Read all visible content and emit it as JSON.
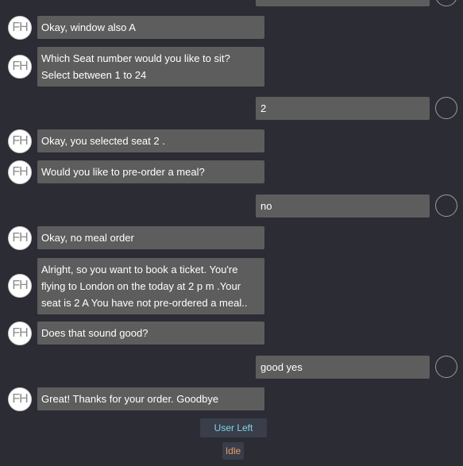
{
  "avatar_initials": "FH",
  "messages": {
    "m1": "Okay, window also A",
    "m2": "Which Seat number would you like to sit?\nSelect between 1 to 24",
    "u1": "2",
    "m3": "Okay, you selected seat 2 .",
    "m4": "Would you like to pre-order a meal?",
    "u2": "no",
    "m5": "Okay, no meal order",
    "m6": "Alright, so you want to book a ticket. You're flying to London on the today at 2 p m .Your seat is 2 A You have not pre-ordered a meal..",
    "m7": "Does that sound good?",
    "u3": "good yes",
    "m8": "Great! Thanks for your order. Goodbye"
  },
  "status": {
    "user_left": "User Left",
    "idle": "Idle"
  },
  "colors": {
    "background": "#2c2c35",
    "bubble": "#5d5d5d",
    "user_left_text": "#7fd6e8",
    "idle_text": "#e0a06a"
  }
}
